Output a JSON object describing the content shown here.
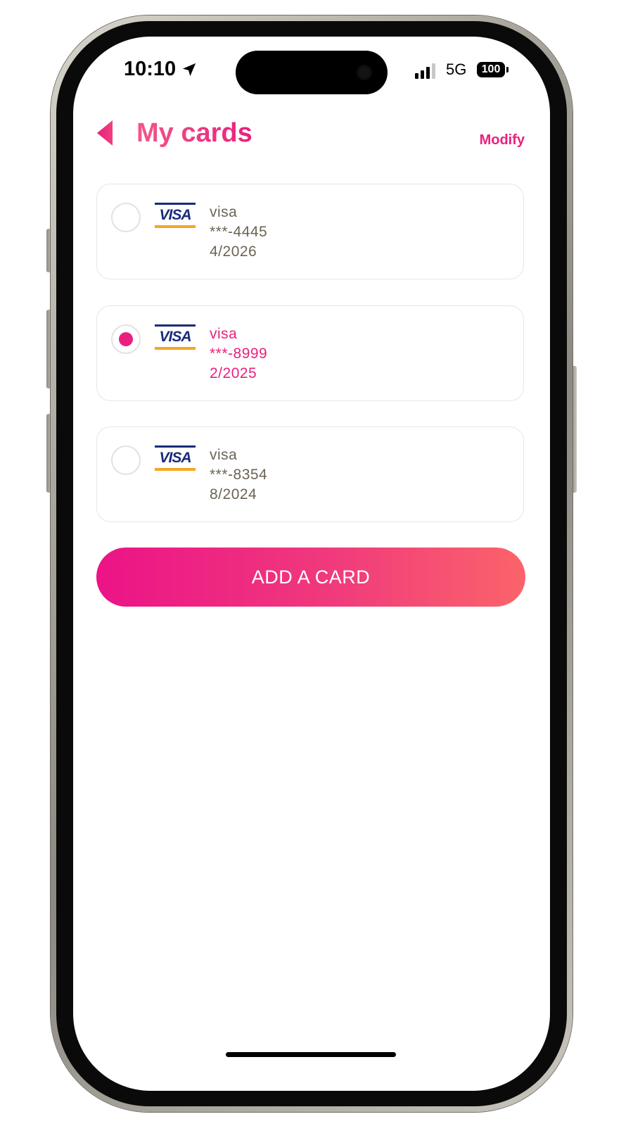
{
  "status_bar": {
    "time": "10:10",
    "network": "5G",
    "battery": "100"
  },
  "header": {
    "title": "My cards",
    "modify_label": "Modify"
  },
  "cards": [
    {
      "brand": "visa",
      "brand_logo": "VISA",
      "number": "***-4445",
      "expiry": "4/2026",
      "selected": false
    },
    {
      "brand": "visa",
      "brand_logo": "VISA",
      "number": "***-8999",
      "expiry": "2/2025",
      "selected": true
    },
    {
      "brand": "visa",
      "brand_logo": "VISA",
      "number": "***-8354",
      "expiry": "8/2024",
      "selected": false
    }
  ],
  "add_button": {
    "label": "ADD A CARD"
  },
  "colors": {
    "accent": "#ea1f7d",
    "gradient_start": "#ec1387",
    "gradient_end": "#fb646a",
    "card_text": "#6b6455",
    "visa_blue": "#1a2b7a",
    "visa_gold": "#f5a623"
  },
  "icons": {
    "back": "back-arrow-icon",
    "location": "location-arrow-icon",
    "signal": "cellular-signal-icon",
    "battery": "battery-icon",
    "card_logo": "visa-logo-icon"
  }
}
